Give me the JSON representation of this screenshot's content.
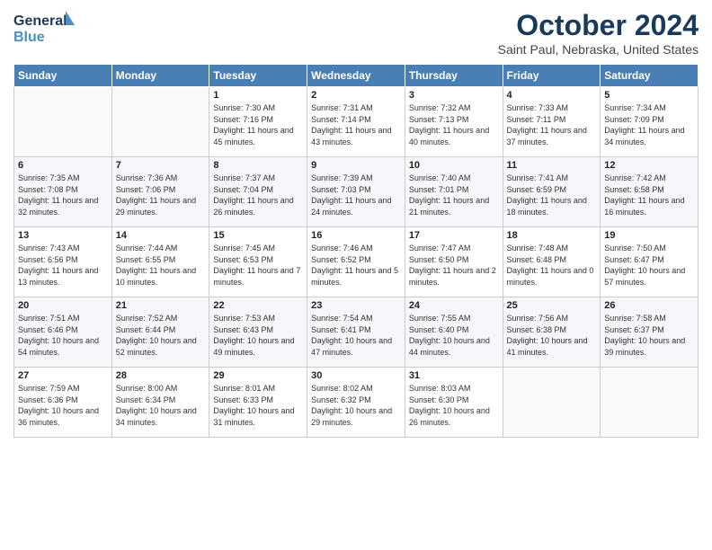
{
  "logo": {
    "line1": "General",
    "line2": "Blue"
  },
  "title": "October 2024",
  "subtitle": "Saint Paul, Nebraska, United States",
  "days_header": [
    "Sunday",
    "Monday",
    "Tuesday",
    "Wednesday",
    "Thursday",
    "Friday",
    "Saturday"
  ],
  "weeks": [
    [
      {
        "num": "",
        "info": ""
      },
      {
        "num": "",
        "info": ""
      },
      {
        "num": "1",
        "info": "Sunrise: 7:30 AM\nSunset: 7:16 PM\nDaylight: 11 hours and 45 minutes."
      },
      {
        "num": "2",
        "info": "Sunrise: 7:31 AM\nSunset: 7:14 PM\nDaylight: 11 hours and 43 minutes."
      },
      {
        "num": "3",
        "info": "Sunrise: 7:32 AM\nSunset: 7:13 PM\nDaylight: 11 hours and 40 minutes."
      },
      {
        "num": "4",
        "info": "Sunrise: 7:33 AM\nSunset: 7:11 PM\nDaylight: 11 hours and 37 minutes."
      },
      {
        "num": "5",
        "info": "Sunrise: 7:34 AM\nSunset: 7:09 PM\nDaylight: 11 hours and 34 minutes."
      }
    ],
    [
      {
        "num": "6",
        "info": "Sunrise: 7:35 AM\nSunset: 7:08 PM\nDaylight: 11 hours and 32 minutes."
      },
      {
        "num": "7",
        "info": "Sunrise: 7:36 AM\nSunset: 7:06 PM\nDaylight: 11 hours and 29 minutes."
      },
      {
        "num": "8",
        "info": "Sunrise: 7:37 AM\nSunset: 7:04 PM\nDaylight: 11 hours and 26 minutes."
      },
      {
        "num": "9",
        "info": "Sunrise: 7:39 AM\nSunset: 7:03 PM\nDaylight: 11 hours and 24 minutes."
      },
      {
        "num": "10",
        "info": "Sunrise: 7:40 AM\nSunset: 7:01 PM\nDaylight: 11 hours and 21 minutes."
      },
      {
        "num": "11",
        "info": "Sunrise: 7:41 AM\nSunset: 6:59 PM\nDaylight: 11 hours and 18 minutes."
      },
      {
        "num": "12",
        "info": "Sunrise: 7:42 AM\nSunset: 6:58 PM\nDaylight: 11 hours and 16 minutes."
      }
    ],
    [
      {
        "num": "13",
        "info": "Sunrise: 7:43 AM\nSunset: 6:56 PM\nDaylight: 11 hours and 13 minutes."
      },
      {
        "num": "14",
        "info": "Sunrise: 7:44 AM\nSunset: 6:55 PM\nDaylight: 11 hours and 10 minutes."
      },
      {
        "num": "15",
        "info": "Sunrise: 7:45 AM\nSunset: 6:53 PM\nDaylight: 11 hours and 7 minutes."
      },
      {
        "num": "16",
        "info": "Sunrise: 7:46 AM\nSunset: 6:52 PM\nDaylight: 11 hours and 5 minutes."
      },
      {
        "num": "17",
        "info": "Sunrise: 7:47 AM\nSunset: 6:50 PM\nDaylight: 11 hours and 2 minutes."
      },
      {
        "num": "18",
        "info": "Sunrise: 7:48 AM\nSunset: 6:48 PM\nDaylight: 11 hours and 0 minutes."
      },
      {
        "num": "19",
        "info": "Sunrise: 7:50 AM\nSunset: 6:47 PM\nDaylight: 10 hours and 57 minutes."
      }
    ],
    [
      {
        "num": "20",
        "info": "Sunrise: 7:51 AM\nSunset: 6:46 PM\nDaylight: 10 hours and 54 minutes."
      },
      {
        "num": "21",
        "info": "Sunrise: 7:52 AM\nSunset: 6:44 PM\nDaylight: 10 hours and 52 minutes."
      },
      {
        "num": "22",
        "info": "Sunrise: 7:53 AM\nSunset: 6:43 PM\nDaylight: 10 hours and 49 minutes."
      },
      {
        "num": "23",
        "info": "Sunrise: 7:54 AM\nSunset: 6:41 PM\nDaylight: 10 hours and 47 minutes."
      },
      {
        "num": "24",
        "info": "Sunrise: 7:55 AM\nSunset: 6:40 PM\nDaylight: 10 hours and 44 minutes."
      },
      {
        "num": "25",
        "info": "Sunrise: 7:56 AM\nSunset: 6:38 PM\nDaylight: 10 hours and 41 minutes."
      },
      {
        "num": "26",
        "info": "Sunrise: 7:58 AM\nSunset: 6:37 PM\nDaylight: 10 hours and 39 minutes."
      }
    ],
    [
      {
        "num": "27",
        "info": "Sunrise: 7:59 AM\nSunset: 6:36 PM\nDaylight: 10 hours and 36 minutes."
      },
      {
        "num": "28",
        "info": "Sunrise: 8:00 AM\nSunset: 6:34 PM\nDaylight: 10 hours and 34 minutes."
      },
      {
        "num": "29",
        "info": "Sunrise: 8:01 AM\nSunset: 6:33 PM\nDaylight: 10 hours and 31 minutes."
      },
      {
        "num": "30",
        "info": "Sunrise: 8:02 AM\nSunset: 6:32 PM\nDaylight: 10 hours and 29 minutes."
      },
      {
        "num": "31",
        "info": "Sunrise: 8:03 AM\nSunset: 6:30 PM\nDaylight: 10 hours and 26 minutes."
      },
      {
        "num": "",
        "info": ""
      },
      {
        "num": "",
        "info": ""
      }
    ]
  ]
}
